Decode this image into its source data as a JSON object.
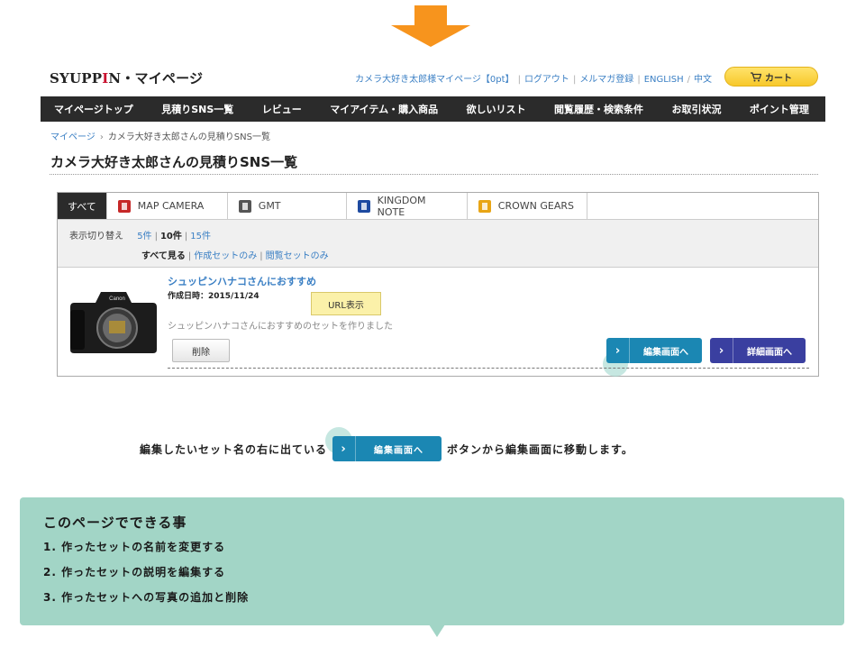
{
  "header": {
    "brand": "SYUPPIN",
    "brand_suffix": "・マイページ",
    "links": [
      "カメラ大好き太郎様マイページ【0pt】",
      "ログアウト",
      "メルマガ登録",
      "ENGLISH",
      "中文"
    ],
    "cart_label": "カート"
  },
  "nav": {
    "items": [
      "マイページトップ",
      "見積りSNS一覧",
      "レビュー",
      "マイアイテム・購入商品",
      "欲しいリスト",
      "閲覧履歴・検索条件",
      "お取引状況",
      "ポイント管理"
    ]
  },
  "breadcrumb": {
    "home": "マイページ",
    "separator": "›",
    "current": "カメラ大好き太郎さんの見積りSNS一覧"
  },
  "page_title": "カメラ大好き太郎さんの見積りSNS一覧",
  "tabs": [
    "すべて",
    "MAP CAMERA",
    "GMT",
    "KINGDOM NOTE",
    "CROWN GEARS"
  ],
  "filter": {
    "label": "表示切り替え",
    "counts": [
      "5件",
      "10件",
      "15件"
    ],
    "views": [
      "すべて見る",
      "作成セットのみ",
      "閲覧セットのみ"
    ]
  },
  "item": {
    "name": "シュッピンハナコさんにおすすめ",
    "date": "作成日時：2015/11/24",
    "url_button": "URL表示",
    "description": "シュッピンハナコさんにおすすめのセットを作りました",
    "delete_button": "削除",
    "edit_button": "編集画面へ",
    "detail_button": "詳細画面へ"
  },
  "instruction": {
    "before": "編集したいセット名の右に出ている",
    "button": "編集画面へ",
    "after": "ボタンから編集画面に移動します。"
  },
  "info": {
    "title": "このページでできる事",
    "items": [
      "1. 作ったセットの名前を変更する",
      "2. 作ったセットの説明を編集する",
      "3. 作ったセットへの写真の追加と削除"
    ]
  },
  "colors": {
    "arrow": "#f7941d",
    "nav_bg": "#2b2b2b",
    "link": "#3a7fc4",
    "edit_button": "#1b87b3",
    "detail_button": "#3a3fa0",
    "info_bg": "#a2d5c6",
    "cart": "#f7c82a"
  }
}
